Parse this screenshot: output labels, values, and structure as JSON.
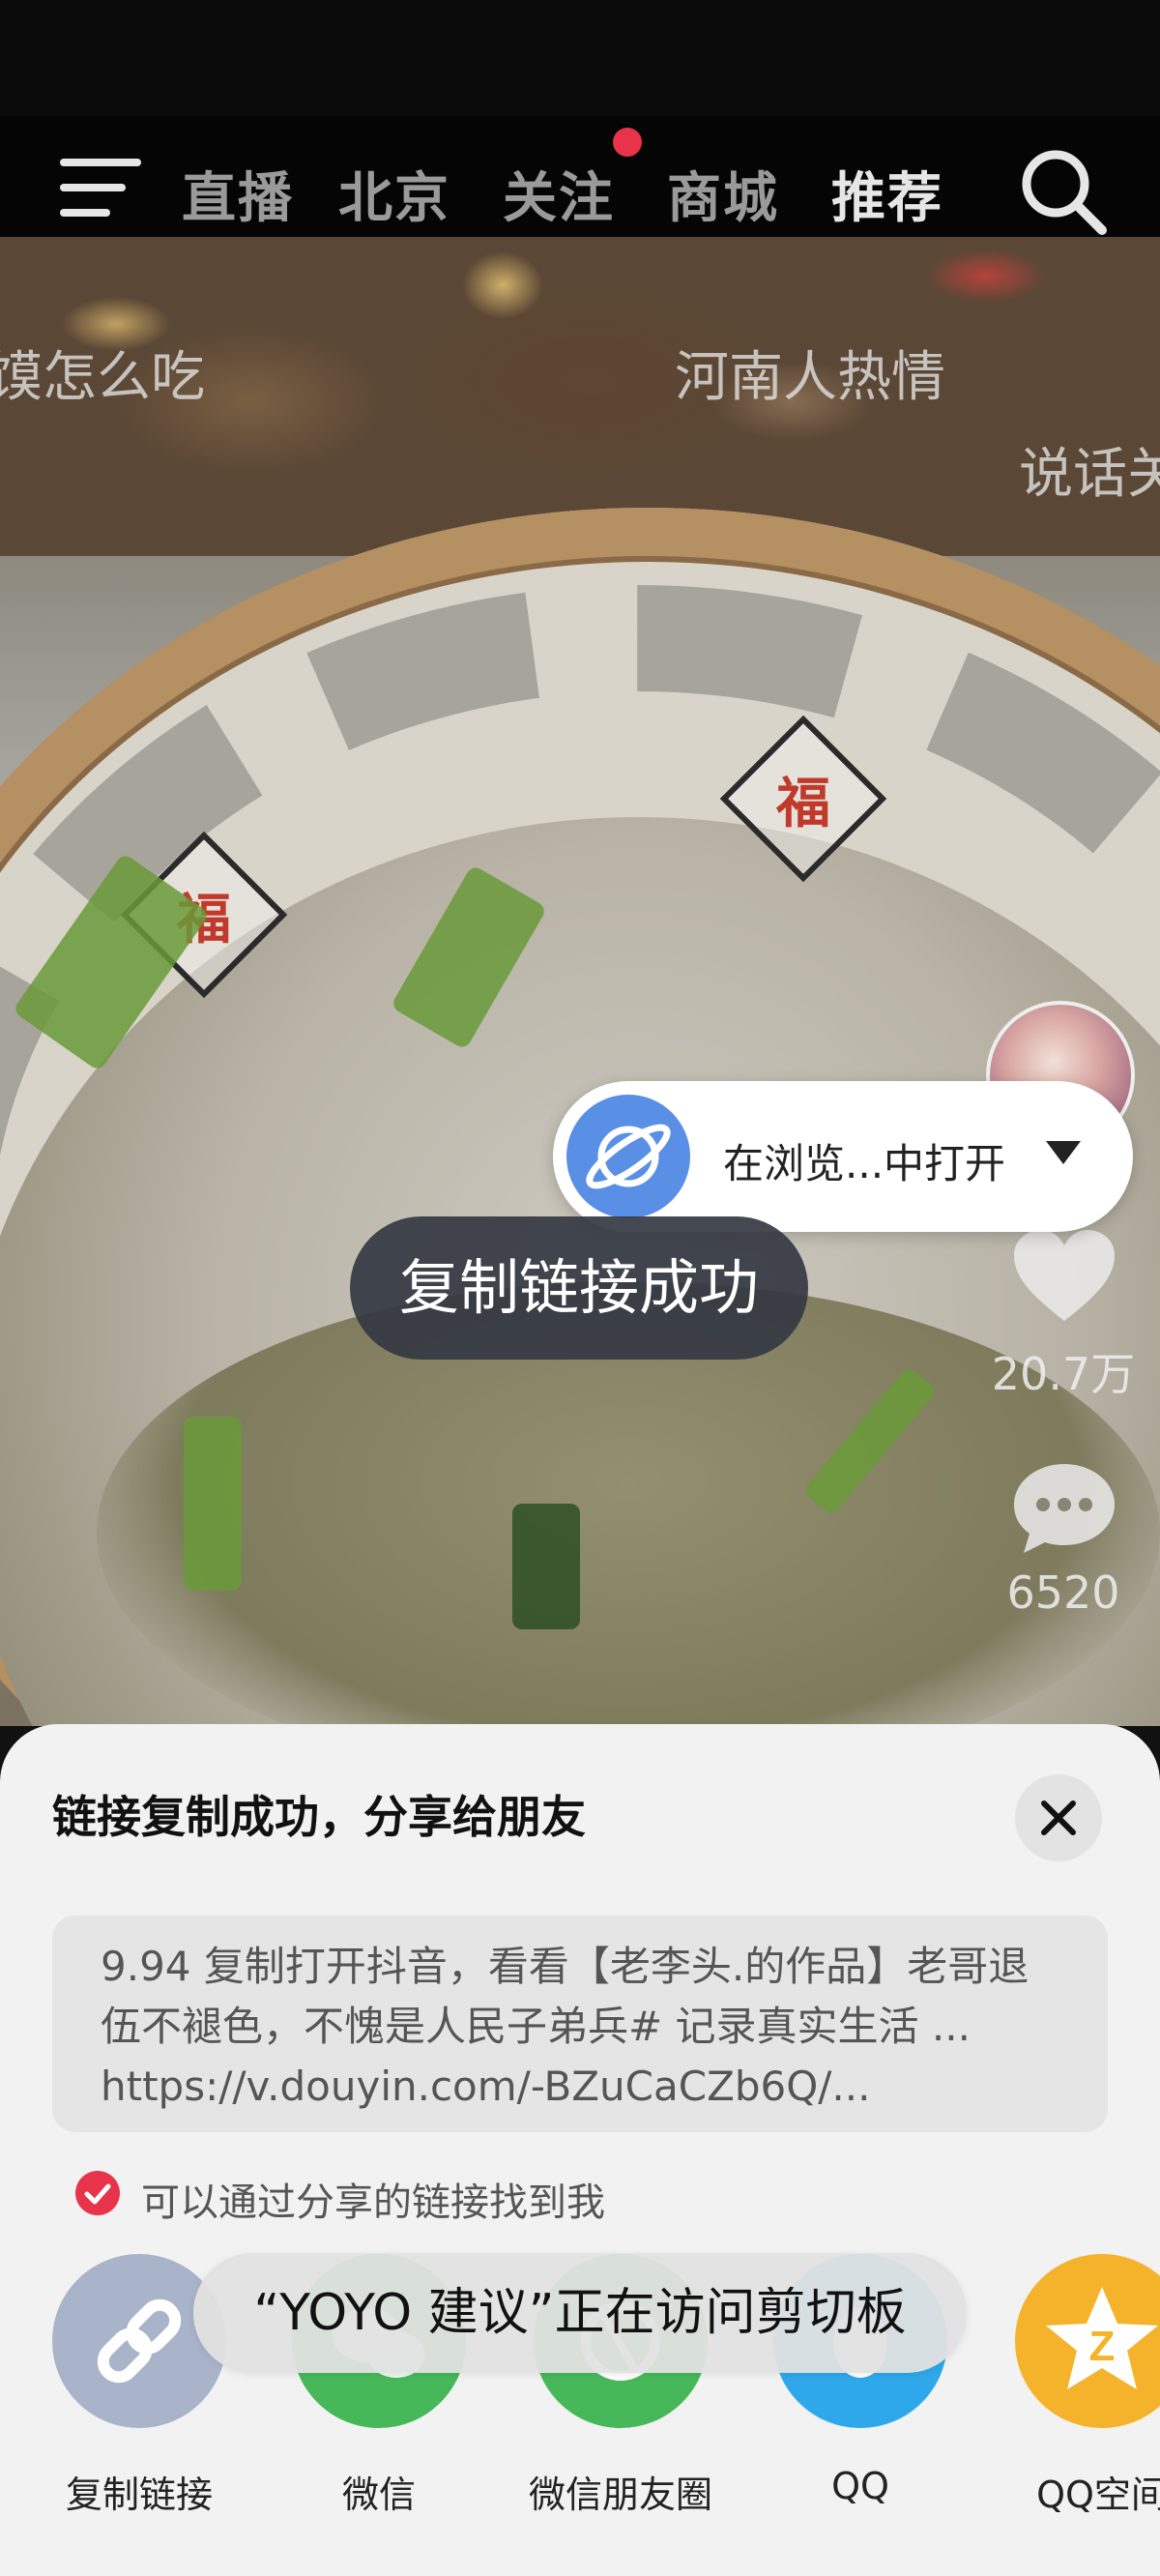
{
  "nav": {
    "tabs": [
      "直播",
      "北京",
      "关注",
      "商城",
      "推荐"
    ],
    "active_tab": "推荐"
  },
  "video": {
    "overlay_texts": [
      "馍怎么吃",
      "河南人热情",
      "说话关"
    ],
    "likes": "20.7万",
    "comments": "6520"
  },
  "browser_pill": {
    "label": "在浏览...中打开"
  },
  "toast_copy": "复制链接成功",
  "share_sheet": {
    "title": "链接复制成功，分享给朋友",
    "link_text": "9.94 复制打开抖音，看看【老李头.的作品】老哥退伍不褪色，不愧是人民子弟兵# 记录真实生活 ... https://v.douyin.com/-BZuCaCZb6Q/...",
    "find_me_label": "可以通过分享的链接找到我",
    "targets": [
      {
        "label": "复制链接",
        "icon": "link-icon",
        "color": "#a9b3c9"
      },
      {
        "label": "微信",
        "icon": "wechat-icon",
        "color": "#46b85a"
      },
      {
        "label": "微信朋友圈",
        "icon": "moments-icon",
        "color": "#46b85a"
      },
      {
        "label": "QQ",
        "icon": "qq-icon",
        "color": "#2ea8ea"
      },
      {
        "label": "QQ空间",
        "icon": "qzone-icon",
        "color": "#f4b32a"
      }
    ]
  },
  "clipboard_toast": "“YOYO 建议”正在访问剪切板",
  "colors": {
    "accent_red": "#e8344a",
    "browser_blue": "#5a8fe6"
  }
}
